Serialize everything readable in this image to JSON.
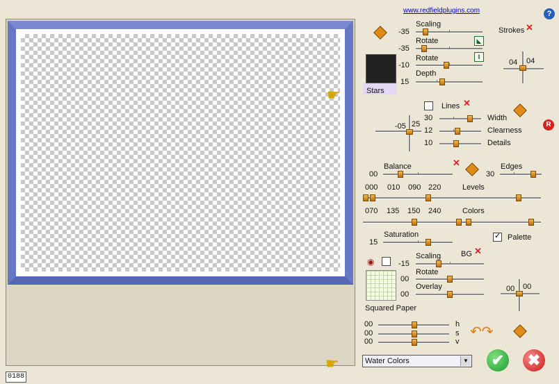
{
  "header": {
    "link": "www.redfieldplugins.com",
    "help": "?"
  },
  "counter": "0188",
  "strokes": {
    "title": "Strokes",
    "scaling": {
      "label": "Scaling",
      "value": "-35",
      "level": 0.3
    },
    "rotate1": {
      "label": "Rotate",
      "value": "-35",
      "level": 0.25
    },
    "rotate2": {
      "label": "Rotate",
      "value": "-10",
      "level": 0.45
    },
    "depth": {
      "label": "Depth",
      "value": "15",
      "level": 0.4
    },
    "cross": {
      "left": "04",
      "right": "04"
    },
    "preset_name": "Stars"
  },
  "lines": {
    "label": "Lines",
    "checked": false,
    "cross": {
      "left": "-05",
      "right": "25"
    },
    "width": {
      "label": "Width",
      "value": "30",
      "level": 0.6
    },
    "clearness": {
      "label": "Clearness",
      "value": "12",
      "level": 0.4
    },
    "details": {
      "label": "Details",
      "value": "10",
      "level": 0.35
    }
  },
  "balance": {
    "label": "Balance",
    "value": "00",
    "level": 0.25
  },
  "edges": {
    "label": "Edges",
    "value": "30",
    "level": 0.8
  },
  "levels": {
    "label": "Levels",
    "values": [
      "000",
      "010",
      "090",
      "220"
    ]
  },
  "colors": {
    "label": "Colors",
    "values": [
      "070",
      "135",
      "150",
      "240"
    ]
  },
  "saturation": {
    "label": "Saturation",
    "value": "15",
    "level": 0.6
  },
  "palette": {
    "label": "Palette",
    "checked": true
  },
  "bg": {
    "title": "BG",
    "scaling": {
      "label": "Scaling",
      "value": "-15",
      "level": 0.3
    },
    "rotate": {
      "label": "Rotate",
      "value": "00",
      "level": 0.5
    },
    "overlay": {
      "label": "Overlay",
      "value": "00",
      "level": 0.5
    },
    "cross": {
      "left": "00",
      "right": "00"
    },
    "paper_name": "Squared Paper"
  },
  "hsv": {
    "h": {
      "label": "h",
      "value": "00"
    },
    "s": {
      "label": "s",
      "value": "00"
    },
    "v": {
      "label": "v",
      "value": "00"
    }
  },
  "preset_dropdown": {
    "value": "Water Colors"
  },
  "buttons": {
    "ok": "✔",
    "cancel": "✖",
    "reset": "R"
  },
  "colors_theme": {
    "accent": "#e08a18",
    "link": "#0000cc",
    "ok": "#1c9c2c",
    "cancel": "#c81818"
  }
}
